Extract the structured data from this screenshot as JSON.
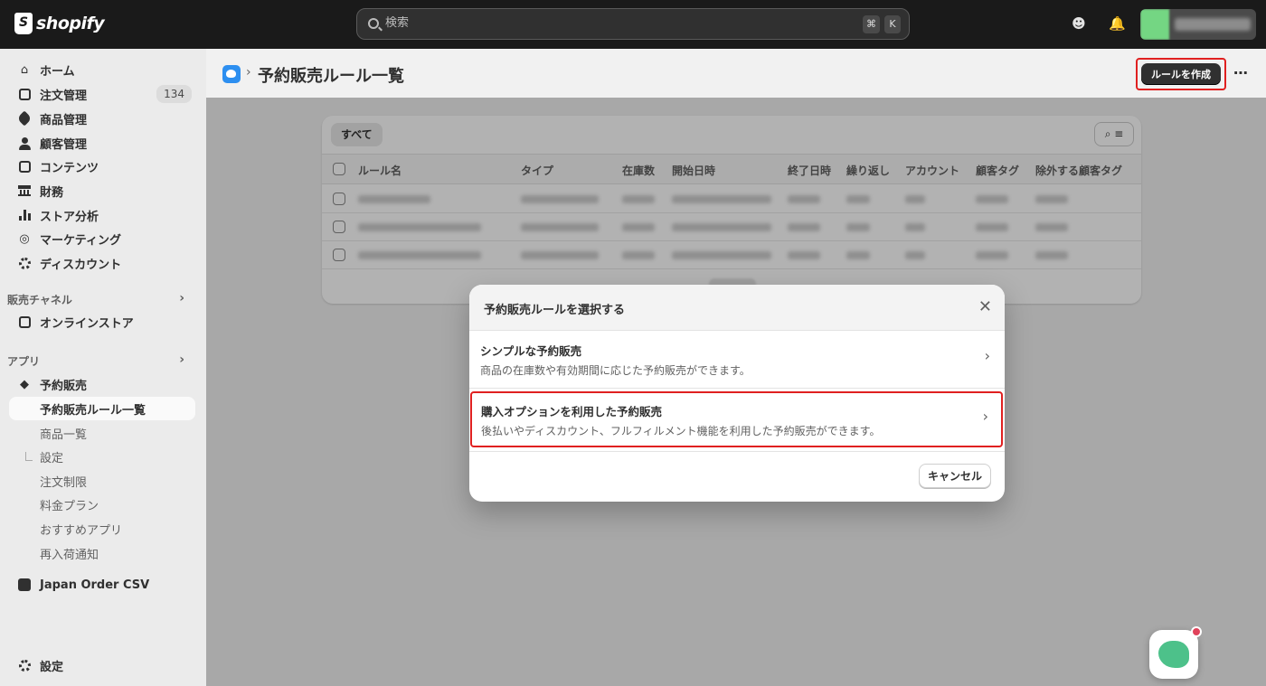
{
  "topbar": {
    "brand": "shopify",
    "search_placeholder": "検索",
    "shortcut_key1": "⌘",
    "shortcut_key2": "K"
  },
  "sidebar": {
    "main_items": [
      {
        "label": "ホーム",
        "icon": "home-icon"
      },
      {
        "label": "注文管理",
        "icon": "inbox-icon",
        "badge": "134"
      },
      {
        "label": "商品管理",
        "icon": "tag-icon"
      },
      {
        "label": "顧客管理",
        "icon": "person-icon"
      },
      {
        "label": "コンテンツ",
        "icon": "content-icon"
      },
      {
        "label": "財務",
        "icon": "bank-icon"
      },
      {
        "label": "ストア分析",
        "icon": "bar-chart-icon"
      },
      {
        "label": "マーケティング",
        "icon": "target-icon"
      },
      {
        "label": "ディスカウント",
        "icon": "discount-icon"
      }
    ],
    "sales_channel_heading": "販売チャネル",
    "online_store": "オンラインストア",
    "apps_heading": "アプリ",
    "app_name": "予約販売",
    "app_subitems": [
      "予約販売ルール一覧",
      "商品一覧",
      "設定",
      "注文制限",
      "料金プラン",
      "おすすめアプリ",
      "再入荷通知"
    ],
    "other_app": "Japan Order CSV",
    "settings": "設定"
  },
  "page": {
    "title": "予約販売ルール一覧",
    "create_button": "ルールを作成",
    "more_button": "⋯"
  },
  "table": {
    "tab_all": "すべて",
    "columns": [
      "ルール名",
      "タイプ",
      "在庫数",
      "開始日時",
      "終了日時",
      "繰り返し",
      "アカウント",
      "顧客タグ",
      "除外する顧客タグ"
    ]
  },
  "modal": {
    "title": "予約販売ルールを選択する",
    "options": [
      {
        "title": "シンプルな予約販売",
        "description": "商品の在庫数や有効期間に応じた予約販売ができます。"
      },
      {
        "title": "購入オプションを利用した予約販売",
        "description": "後払いやディスカウント、フルフィルメント機能を利用した予約販売ができます。"
      }
    ],
    "cancel": "キャンセル"
  },
  "colors": {
    "topbar_bg": "#1a1a1a",
    "highlight_red": "#e02020",
    "primary_button": "#303030"
  }
}
